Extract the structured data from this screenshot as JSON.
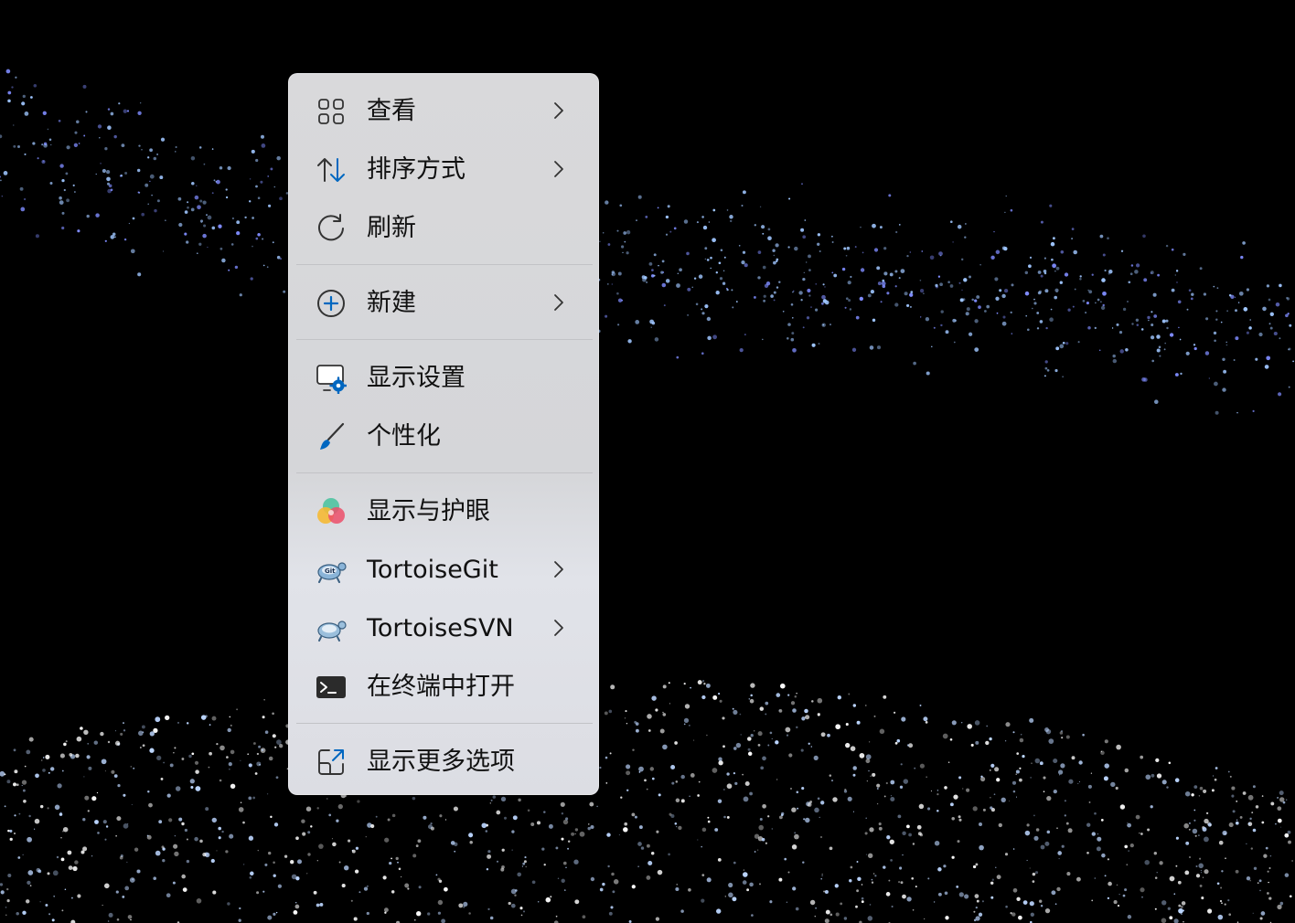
{
  "context_menu": {
    "items": [
      {
        "label": "查看",
        "icon": "grid-view-icon",
        "has_submenu": true
      },
      {
        "label": "排序方式",
        "icon": "sort-arrows-icon",
        "has_submenu": true
      },
      {
        "label": "刷新",
        "icon": "refresh-icon",
        "has_submenu": false
      },
      {
        "label": "新建",
        "icon": "add-circle-icon",
        "has_submenu": true
      },
      {
        "label": "显示设置",
        "icon": "display-settings-icon",
        "has_submenu": false
      },
      {
        "label": "个性化",
        "icon": "paintbrush-icon",
        "has_submenu": false
      },
      {
        "label": "显示与护眼",
        "icon": "color-circles-icon",
        "has_submenu": false
      },
      {
        "label": "TortoiseGit",
        "icon": "tortoisegit-icon",
        "has_submenu": true
      },
      {
        "label": "TortoiseSVN",
        "icon": "tortoisesvn-icon",
        "has_submenu": true
      },
      {
        "label": "在终端中打开",
        "icon": "terminal-icon",
        "has_submenu": false
      },
      {
        "label": "显示更多选项",
        "icon": "open-external-icon",
        "has_submenu": false
      }
    ]
  },
  "colors": {
    "accent": "#0067c0",
    "menu_background": "#d9d9db",
    "text": "#111111",
    "separator": "#c2c3c6"
  }
}
